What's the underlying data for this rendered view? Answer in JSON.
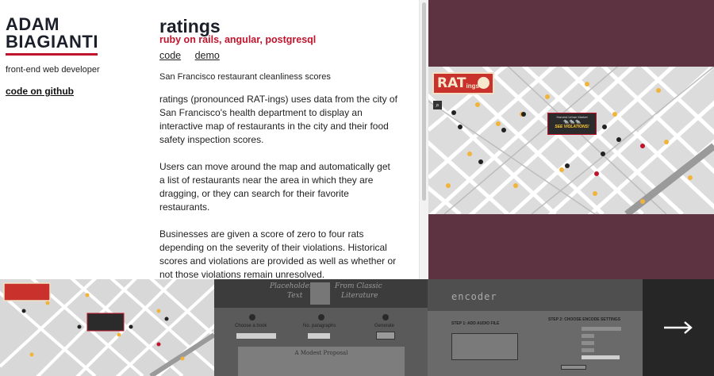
{
  "sidebar": {
    "name_line1": "ADAM",
    "name_line2": "BIAGIANTI",
    "tagline": "front-end web developer",
    "github_link": "code on github"
  },
  "project": {
    "title": "ratings",
    "tech": "ruby on rails, angular, postgresql",
    "links": {
      "code": "code",
      "demo": "demo"
    },
    "subtitle": "San Francisco restaurant cleanliness scores",
    "paragraphs": [
      "ratings (pronounced RAT-ings) uses data from the city of San Francisco's health department to display an interactive map of restaurants in the city and their food safety inspection scores.",
      "Users can move around the map and automatically get a list of restaurants near the area in which they are dragging, or they can search for their favorite restaurants.",
      "Businesses are given a score of zero to four rats depending on the severity of their violations. Historical scores and violations are provided as well as whether or not those violations remain unresolved."
    ]
  },
  "preview": {
    "logo_main": "RAT",
    "logo_small": "ings",
    "popup_title": "Harvest Urban Market",
    "popup_rats": "🐀🐀🐀",
    "popup_warning": "SEE VIOLATIONS!"
  },
  "thumbnails": {
    "placeholder": {
      "left_title": "Placeholder",
      "left_title2": "Text",
      "right_title": "From Classic",
      "right_title2": "Literature",
      "step1": "Choose a book",
      "step2": "No. paragraphs",
      "step3": "Generate",
      "card_title": "A Modest Proposal"
    },
    "encoder": {
      "title": "encoder",
      "step1": "STEP 1: ADD AUDIO FILE",
      "step2": "STEP 2: CHOOSE ENCODE SETTINGS"
    }
  },
  "colors": {
    "accent": "#c0142c",
    "preview_bg": "#5d3241",
    "strip_bg": "#262626"
  },
  "icons": {
    "next": "arrow-right-icon",
    "search": "search-icon",
    "rat": "rat-icon"
  }
}
